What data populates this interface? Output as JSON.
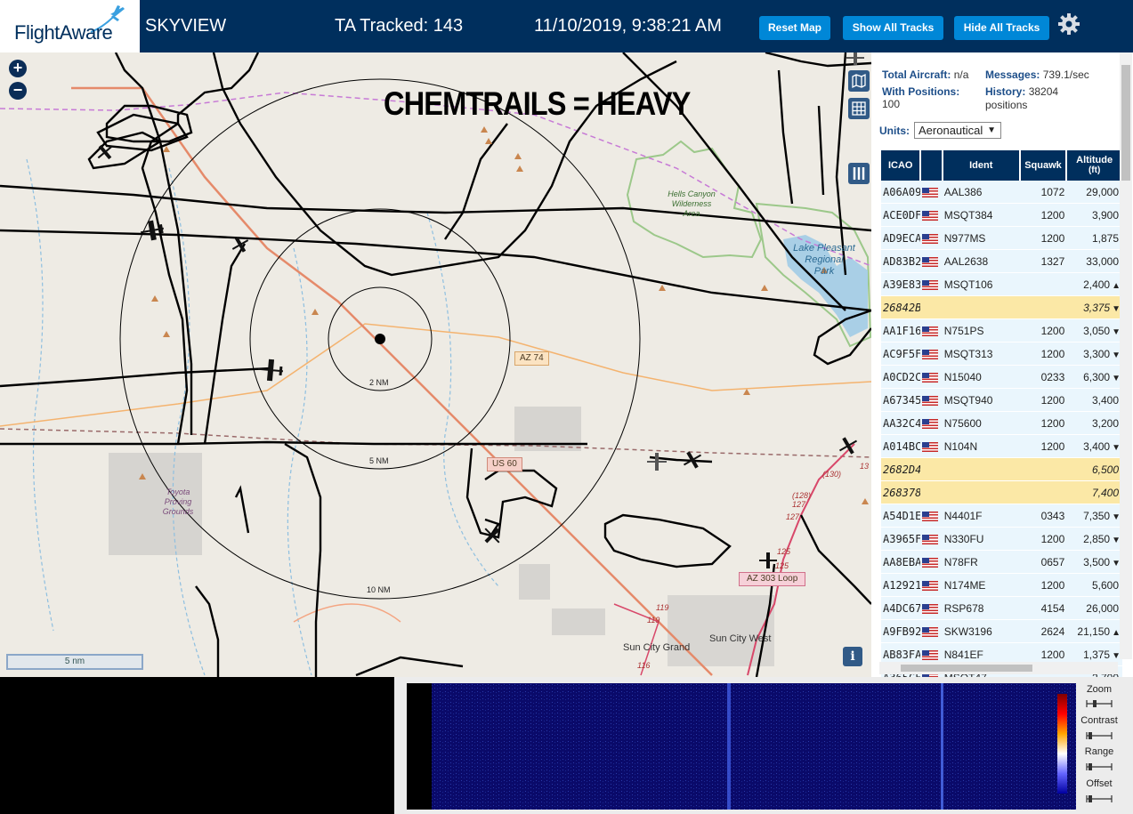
{
  "header": {
    "logo_text": "FlightAware",
    "app_title": "SKYVIEW",
    "tracked_label": "TA Tracked: 143",
    "datetime": "11/10/2019, 9:38:21 AM",
    "buttons": {
      "reset_map": "Reset Map",
      "show_all_tracks": "Show All Tracks",
      "hide_all_tracks": "Hide All Tracks"
    },
    "settings_icon": "gear-icon"
  },
  "map": {
    "overlay_caption": "CHEMTRAILS = HEAVY",
    "range_rings": [
      "2 NM",
      "5 NM",
      "10 NM"
    ],
    "road_labels": [
      "AZ 74",
      "US 60",
      "AZ 303 Loop"
    ],
    "place_labels": {
      "hells_canyon": [
        "Hells Canyon",
        "Wilderness",
        "Area"
      ],
      "lake_pleasant": [
        "Lake Pleasant",
        "Regional",
        "Park"
      ],
      "toyota": [
        "Toyota",
        "Proving",
        "Grounds"
      ],
      "sun_city_grand": "Sun City Grand",
      "sun_city_west": "Sun City West"
    },
    "exit_numbers": [
      "(130)",
      "(128)",
      "127",
      "127",
      "125",
      "125",
      "119",
      "119",
      "116",
      "13"
    ],
    "scale_label": "5 nm",
    "zoom_in": "+",
    "zoom_out": "−",
    "info_label": "i"
  },
  "stats": {
    "total_aircraft_label": "Total Aircraft:",
    "total_aircraft_value": "n/a",
    "messages_label": "Messages:",
    "messages_value": "739.1/sec",
    "with_positions_label": "With Positions:",
    "with_positions_value": "100",
    "history_label": "History:",
    "history_value": "38204",
    "history_unit": "positions"
  },
  "units": {
    "label": "Units:",
    "selected": "Aeronautical"
  },
  "table": {
    "headers": {
      "icao": "ICAO",
      "flag": "",
      "ident": "Ident",
      "squawk": "Squawk",
      "altitude": "Altitude",
      "altitude_unit": "(ft)"
    },
    "rows": [
      {
        "icao": "A06A09",
        "flag": true,
        "ident": "AAL386",
        "squawk": "1072",
        "altitude": "29,000",
        "trend": "",
        "highlight": false
      },
      {
        "icao": "ACE0DF",
        "flag": true,
        "ident": "MSQT384",
        "squawk": "1200",
        "altitude": "3,900",
        "trend": "",
        "highlight": false
      },
      {
        "icao": "AD9ECA",
        "flag": true,
        "ident": "N977MS",
        "squawk": "1200",
        "altitude": "1,875",
        "trend": "",
        "highlight": false
      },
      {
        "icao": "AD83B2",
        "flag": true,
        "ident": "AAL2638",
        "squawk": "1327",
        "altitude": "33,000",
        "trend": "",
        "highlight": false
      },
      {
        "icao": "A39E83",
        "flag": true,
        "ident": "MSQT106",
        "squawk": "",
        "altitude": "2,400",
        "trend": "▲",
        "highlight": false
      },
      {
        "icao": "26842B",
        "flag": false,
        "ident": "",
        "squawk": "",
        "altitude": "3,375",
        "trend": "▼",
        "highlight": true
      },
      {
        "icao": "AA1F16",
        "flag": true,
        "ident": "N751PS",
        "squawk": "1200",
        "altitude": "3,050",
        "trend": "▼",
        "highlight": false
      },
      {
        "icao": "AC9F5F",
        "flag": true,
        "ident": "MSQT313",
        "squawk": "1200",
        "altitude": "3,300",
        "trend": "▼",
        "highlight": false
      },
      {
        "icao": "A0CD2C",
        "flag": true,
        "ident": "N15040",
        "squawk": "0233",
        "altitude": "6,300",
        "trend": "▼",
        "highlight": false
      },
      {
        "icao": "A67345",
        "flag": true,
        "ident": "MSQT940",
        "squawk": "1200",
        "altitude": "3,400",
        "trend": "",
        "highlight": false
      },
      {
        "icao": "AA32C4",
        "flag": true,
        "ident": "N75600",
        "squawk": "1200",
        "altitude": "3,200",
        "trend": "",
        "highlight": false
      },
      {
        "icao": "A014BC",
        "flag": true,
        "ident": "N104N",
        "squawk": "1200",
        "altitude": "3,400",
        "trend": "▼",
        "highlight": false
      },
      {
        "icao": "2682D4",
        "flag": false,
        "ident": "",
        "squawk": "",
        "altitude": "6,500",
        "trend": "",
        "highlight": true
      },
      {
        "icao": "268378",
        "flag": false,
        "ident": "",
        "squawk": "",
        "altitude": "7,400",
        "trend": "",
        "highlight": true
      },
      {
        "icao": "A54D1E",
        "flag": true,
        "ident": "N4401F",
        "squawk": "0343",
        "altitude": "7,350",
        "trend": "▼",
        "highlight": false
      },
      {
        "icao": "A3965F",
        "flag": true,
        "ident": "N330FU",
        "squawk": "1200",
        "altitude": "2,850",
        "trend": "▼",
        "highlight": false
      },
      {
        "icao": "AA8EBA",
        "flag": true,
        "ident": "N78FR",
        "squawk": "0657",
        "altitude": "3,500",
        "trend": "▼",
        "highlight": false
      },
      {
        "icao": "A12921",
        "flag": true,
        "ident": "N174ME",
        "squawk": "1200",
        "altitude": "5,600",
        "trend": "",
        "highlight": false
      },
      {
        "icao": "A4DC67",
        "flag": true,
        "ident": "RSP678",
        "squawk": "4154",
        "altitude": "26,000",
        "trend": "",
        "highlight": false
      },
      {
        "icao": "A9FB92",
        "flag": true,
        "ident": "SKW3196",
        "squawk": "2624",
        "altitude": "21,150",
        "trend": "▲",
        "highlight": false
      },
      {
        "icao": "AB83FA",
        "flag": true,
        "ident": "N841EF",
        "squawk": "1200",
        "altitude": "1,375",
        "trend": "▼",
        "highlight": false
      },
      {
        "icao": "A365CF",
        "flag": true,
        "ident": "MSQT47",
        "squawk": "",
        "altitude": "2,700",
        "trend": "",
        "highlight": false
      }
    ]
  },
  "spectrum": {
    "controls": [
      "Zoom",
      "Contrast",
      "Range",
      "Offset"
    ]
  },
  "colors": {
    "header_bg": "#002f5d",
    "button_bg": "#0087d7",
    "row_bg": "#eaf6fd",
    "row_highlight": "#fbe8a6",
    "map_bg": "#eeebe4",
    "track_line": "#000000",
    "road_primary": "#f4a460"
  }
}
